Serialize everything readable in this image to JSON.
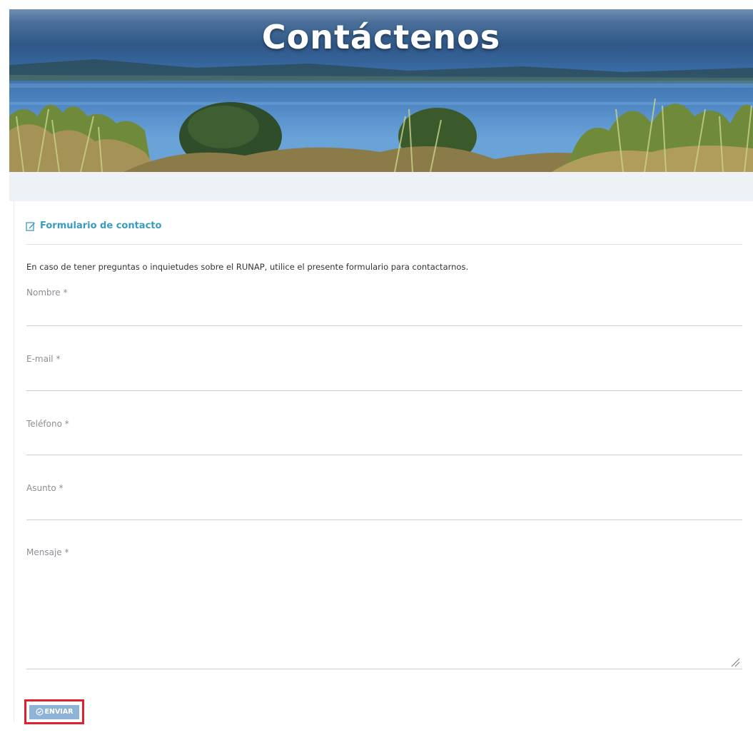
{
  "hero": {
    "title": "Contáctenos"
  },
  "form": {
    "title": "Formulario de contacto",
    "title_icon": "edit-icon",
    "intro": "En caso de tener preguntas o inquietudes sobre el RUNAP, utilice el presente formulario para contactarnos.",
    "fields": [
      {
        "label": "Nombre *",
        "value": ""
      },
      {
        "label": "E-mail *",
        "value": ""
      },
      {
        "label": "Teléfono *",
        "value": ""
      },
      {
        "label": "Asunto *",
        "value": ""
      },
      {
        "label": "Mensaje *",
        "value": ""
      }
    ],
    "submit_label": "ENVIAR",
    "submit_icon": "check-circle-icon"
  },
  "colors": {
    "accent": "#3a9bc0",
    "button": "#8fb3d6",
    "highlight": "#e0212b",
    "band": "#eef2f6"
  }
}
